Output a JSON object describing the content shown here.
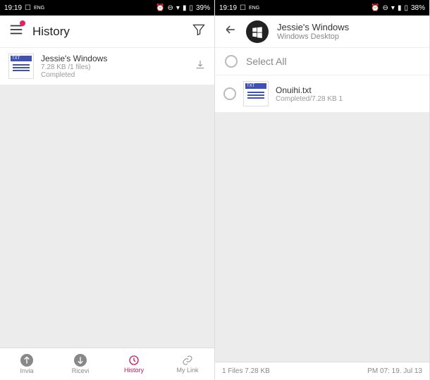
{
  "left": {
    "statusbar": {
      "time": "19:19",
      "battery": "39%"
    },
    "title": "History",
    "entry": {
      "badge": "TXT",
      "name": "Jessie's Windows",
      "meta": "7.28 KB /1 files)",
      "status": "Completed"
    },
    "nav": {
      "send": "Invia",
      "receive": "Ricevi",
      "history": "History",
      "mylink": "My Link"
    }
  },
  "right": {
    "statusbar": {
      "time": "19:19",
      "battery": "38%"
    },
    "device": {
      "name": "Jessie's Windows",
      "sub": "Windows Desktop"
    },
    "selectAll": "Select All",
    "entry": {
      "badge": "TXT",
      "name": "Onuihi.txt",
      "meta": "Completed/7.28 KB 1"
    },
    "footer": {
      "left": "1 Files 7.28 KB",
      "right": "PM 07: 19. Jul 13"
    }
  }
}
